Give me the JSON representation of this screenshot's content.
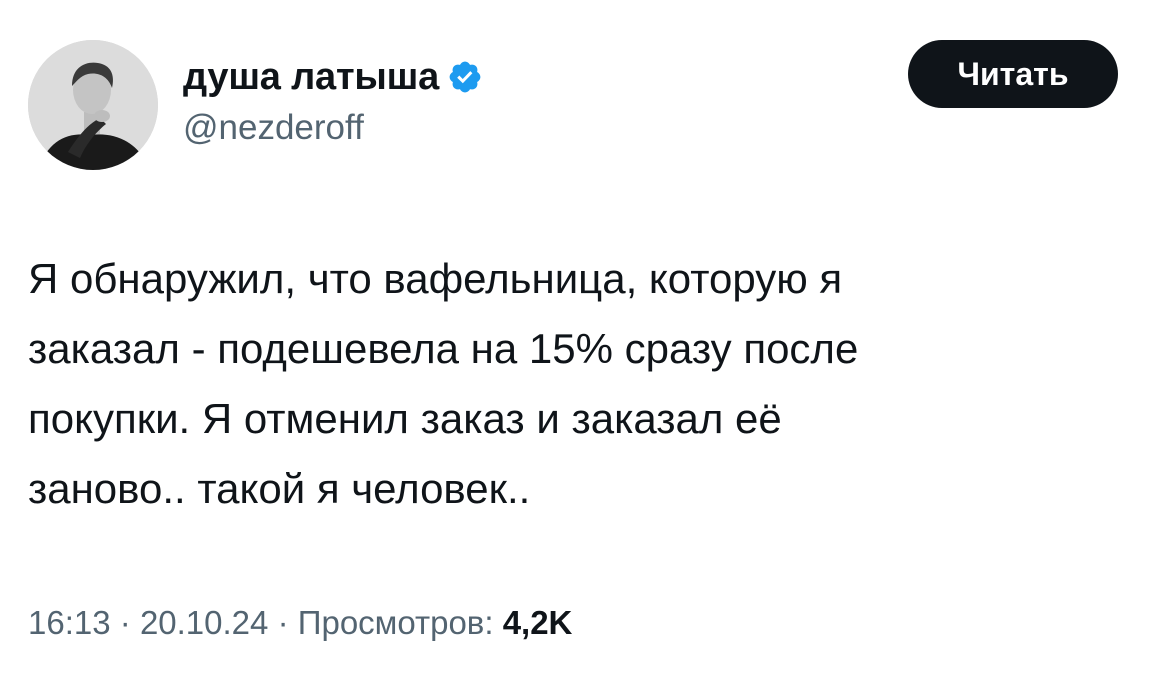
{
  "author": {
    "display_name": "душа латыша",
    "handle": "@nezderoff",
    "verified": true,
    "verified_color": "#1d9bf0"
  },
  "follow_button": {
    "label": "Читать",
    "background": "#0f1419",
    "text_color": "#ffffff"
  },
  "tweet": {
    "text": "Я обнаружил, что вафельница, которую я\nзаказал - подешевела на 15% сразу после\nпокупки. Я отменил заказ и заказал её\nзаново.. такой я человек.."
  },
  "meta": {
    "time": "16:13",
    "separator": "·",
    "date": "20.10.24",
    "views_label": "Просмотров:",
    "views_count": "4,2K"
  },
  "icons": {
    "verified": "verified-badge-icon",
    "avatar": "profile-avatar"
  }
}
